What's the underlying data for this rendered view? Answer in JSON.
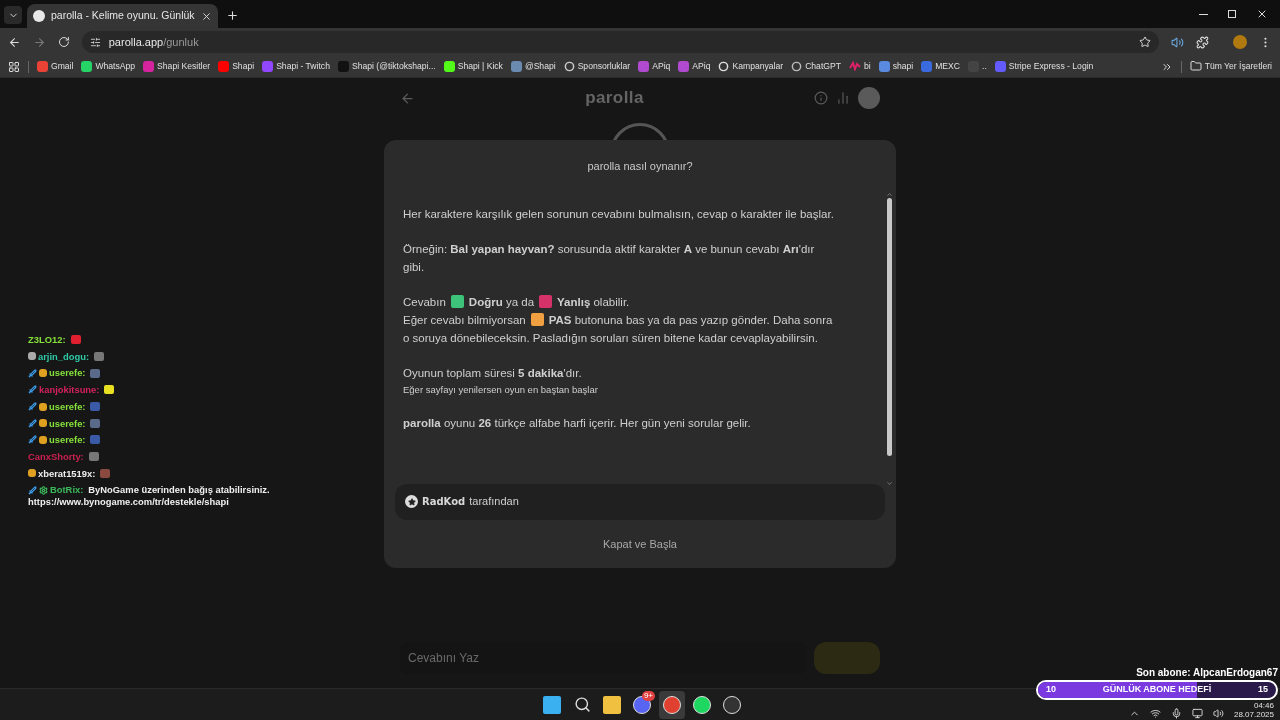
{
  "browser": {
    "tab": {
      "title": "parolla - Kelime oyunu. Günlük",
      "selected": true
    },
    "address": {
      "host": "parolla.app",
      "path": "/gunluk"
    },
    "bookmarks": [
      "Gmail",
      "WhatsApp",
      "Shapi Kesitler",
      "Shapi",
      "Shapi - Twitch",
      "Shapi (@tiktokshapi...",
      "Shapi | Kick",
      "@Shapi",
      "Sponsorluklar",
      "APiq",
      "APiq",
      "Kampanyalar",
      "ChatGPT",
      "bi",
      "shapi",
      "MEXC",
      "..",
      "Stripe Express - Login"
    ],
    "all_bookmarks": "Tüm Yer İşaretleri"
  },
  "chat": [
    {
      "user": "Z3LO12:",
      "color": "#86e03c"
    },
    {
      "user": "arjin_dogu:",
      "color": "#2fc9a6"
    },
    {
      "user": "userefe:",
      "color": "#86e03c"
    },
    {
      "user": "kanjokitsune:",
      "color": "#d4205c"
    },
    {
      "user": "userefe:",
      "color": "#86e03c"
    },
    {
      "user": "userefe:",
      "color": "#86e03c"
    },
    {
      "user": "userefe:",
      "color": "#86e03c"
    },
    {
      "user": "CanxShorty:",
      "color": "#c8204f"
    },
    {
      "user": "xberat1519x:",
      "color": "#f0f0f0"
    },
    {
      "user": "BotRix:",
      "color": "#3cba5c",
      "message": "ByNoGame üzerinden bağış atabilirsiniz.",
      "link": "https://www.bynogame.com/tr/destekle/shapi"
    }
  ],
  "page": {
    "logo": "parolla",
    "answer_placeholder": "Cevabını Yaz"
  },
  "modal": {
    "title": "parolla nasıl oynanır?",
    "paragraphs": [
      {
        "kind": "text",
        "parts": [
          {
            "kind": "text",
            "text": "Her karaktere karşılık gelen sorunun cevabını bulmalısın, cevap o karakter ile başlar."
          }
        ]
      },
      {
        "kind": "text",
        "parts": [
          {
            "kind": "text",
            "text": "Örneğin: **Bal yapan hayvan?** sorusunda aktif karakter **A** ve bunun cevabı **Arı**'dır"
          },
          {
            "kind": "break"
          },
          {
            "kind": "text",
            "text": "gibi."
          }
        ]
      },
      {
        "kind": "text",
        "parts": [
          {
            "kind": "text",
            "text": "Cevabın"
          },
          {
            "kind": "swatch",
            "color": "#3ec47a"
          },
          {
            "kind": "text",
            "text": "**Doğru** ya da"
          },
          {
            "kind": "swatch",
            "color": "#d6326a"
          },
          {
            "kind": "text",
            "text": "**Yanlış** olabilir."
          },
          {
            "kind": "break"
          },
          {
            "kind": "text",
            "text": "Eğer cevabı bilmiyorsan"
          },
          {
            "kind": "swatch",
            "color": "#f0a040"
          },
          {
            "kind": "text",
            "text": "**PAS** butonuna bas ya da pas yazıp gönder. Daha sonra"
          },
          {
            "kind": "break"
          },
          {
            "kind": "text",
            "text": "o soruya dönebileceksin. Pasladığın soruları süren bitene kadar cevaplayabilirsin."
          }
        ]
      },
      {
        "kind": "text",
        "parts": [
          {
            "kind": "text",
            "text": "Oyunun toplam süresi **5 dakika**'dır."
          }
        ]
      },
      {
        "kind": "note",
        "parts": [
          {
            "kind": "text",
            "text": "Eğer sayfayı yenilersen oyun en baştan başlar"
          }
        ]
      },
      {
        "kind": "text",
        "parts": [
          {
            "kind": "text",
            "text": "**parolla** oyunu **26** türkçe alfabe harfi içerir. Her gün yeni sorular gelir."
          }
        ]
      }
    ],
    "credit": {
      "author": "RadKod",
      "suffix": "tarafından"
    },
    "close_button": "Kapat ve Başla"
  },
  "stream_overlay": {
    "last_sub": "Son abone: AlpcanErdogan67",
    "goal": {
      "current": "10",
      "title": "GÜNLÜK ABONE HEDEFİ",
      "target": "15",
      "level": 0.67
    }
  },
  "taskbar": {
    "apps": [
      {
        "selected": false
      },
      {
        "selected": false
      },
      {
        "selected": false
      },
      {
        "selected": false,
        "badge": "9+"
      },
      {
        "selected": true
      },
      {
        "selected": false
      },
      {
        "selected": false
      }
    ],
    "time": "04:46",
    "date": "28.07.2025"
  }
}
